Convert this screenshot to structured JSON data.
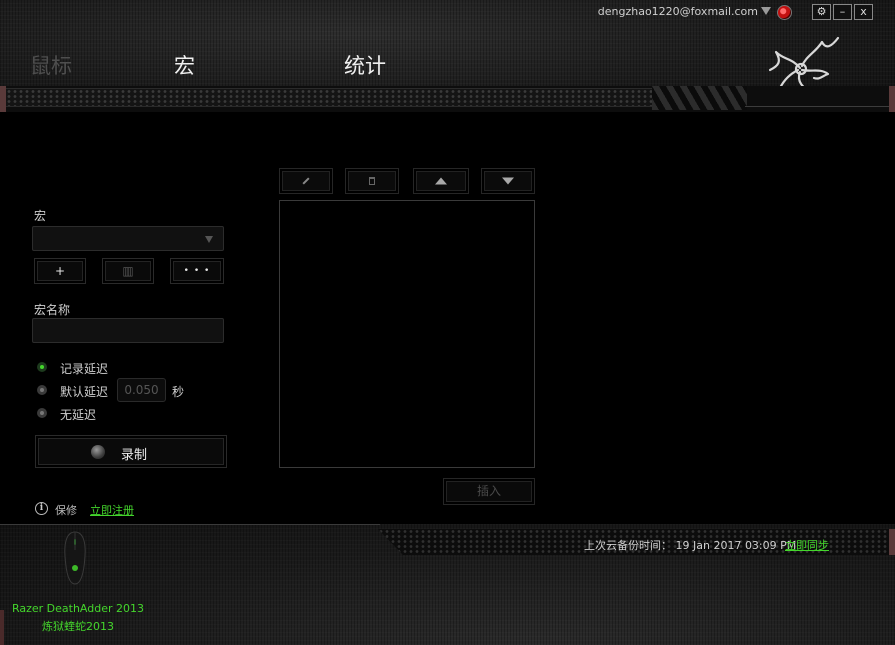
{
  "account": {
    "email": "dengzhao1220@foxmail.com",
    "window_buttons": [
      "⚙",
      "–",
      "x"
    ]
  },
  "nav": {
    "tabs": [
      {
        "label": "鼠标",
        "active": false
      },
      {
        "label": "宏",
        "active": true
      },
      {
        "label": "统计",
        "active": false
      }
    ]
  },
  "macro": {
    "section_label": "宏",
    "selected_macro": "",
    "add_label": "+",
    "delete_label": "▥",
    "more_label": "• • •",
    "name_label": "宏名称",
    "name_value": "",
    "delay_options": [
      {
        "label": "记录延迟",
        "selected": true
      },
      {
        "label": "默认延迟",
        "selected": false
      },
      {
        "label": "无延迟",
        "selected": false
      }
    ],
    "default_delay_value": "0.050",
    "delay_unit": "秒",
    "record_label": "录制"
  },
  "warranty": {
    "label": "保修",
    "register_link": "立即注册"
  },
  "editor": {
    "insert_label": "插入"
  },
  "footer": {
    "backup_label": "上次云备份时间：",
    "backup_time": "19 Jan 2017 03:09 PM",
    "sync_link": "立即同步",
    "device_name_en": "Razer DeathAdder 2013",
    "device_name_cn": "炼狱蝰蛇2013"
  },
  "colors": {
    "accent_green": "#44d62c",
    "background": "#000000"
  }
}
